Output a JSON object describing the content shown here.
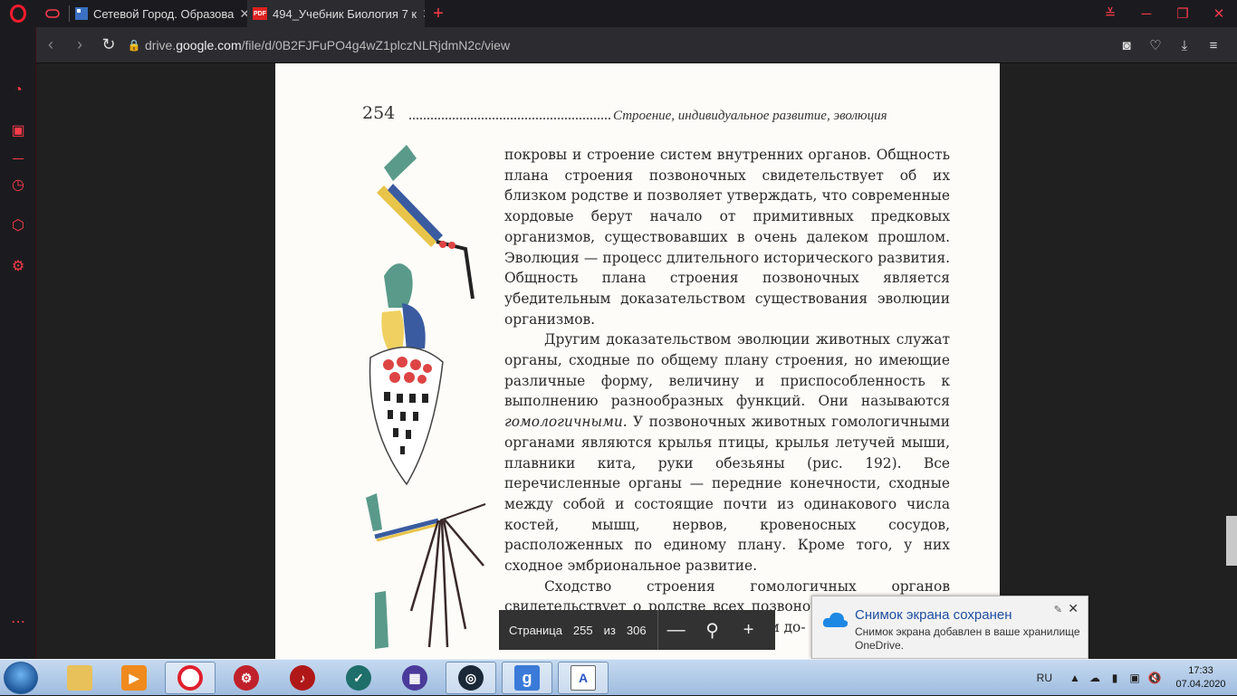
{
  "tabs": [
    {
      "label": "Сетевой Город. Образова",
      "close": "✕"
    },
    {
      "label": "494_Учебник Биология 7 к",
      "close": "✕",
      "badge": "PDF"
    }
  ],
  "newtab": "+",
  "address": {
    "prefix": "drive.",
    "domain": "google.com",
    "path": "/file/d/0B2FJFuPO4g4wZ1plczNLRjdmN2c/view"
  },
  "book": {
    "page_number": "254",
    "running_head": "Строение, индивидуальное развитие, эволюция",
    "para1": "покровы и строение систем внутренних органов. Общность плана строения позвоночных свидетельствует об их близком родстве и позволяет утверждать, что современные хордовые берут начало от примитивных предковых организмов, существовавших в очень далеком прошлом. Эволюция — процесс длительного исторического развития. Общность плана строения позвоночных является убедительным доказательством существования эволюции организмов.",
    "para2_a": "Другим доказательством эволюции животных служат органы, сходные по общему плану строения, но имеющие различные форму, величину и приспособленность к выполнению разнообразных функций. Они называются ",
    "para2_em": "гомологичными",
    "para2_b": ". У позвоночных животных гомологичными органами являются крылья птицы, крылья летучей мыши, плавники кита, руки обезьяны (рис. 192). Все перечисленные органы — передние конечности, сходные между собой и состоящие почти из одинакового числа костей, мышц, нервов, кровеносных сосудов, расположенных по единому плану. Кроме того, у них сходное эмбриональное развитие.",
    "para3": "Сходство строения гомологичных органов свидетельствует о родстве всех позвоночных и их едином происхождении и служит еще одним до-"
  },
  "pager": {
    "label": "Страница",
    "current": "255",
    "of": "из",
    "total": "306"
  },
  "toast": {
    "title": "Снимок экрана сохранен",
    "body": "Снимок экрана добавлен в ваше хранилище OneDrive."
  },
  "tray": {
    "lang": "RU",
    "time": "17:33",
    "date": "07.04.2020"
  },
  "colors": {
    "opera_red": "#ff1b2d",
    "toast_title": "#1f4ea1"
  }
}
